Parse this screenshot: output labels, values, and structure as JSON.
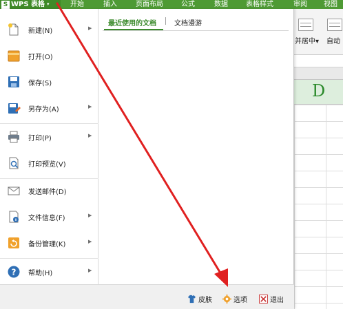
{
  "app": {
    "logo_glyph": "S",
    "title": "WPS 表格",
    "caret": "▾"
  },
  "ribbon_tabs": [
    "开始",
    "插入",
    "页面布局",
    "公式",
    "数据",
    "表格样式",
    "审阅",
    "视图"
  ],
  "menu_items": [
    {
      "label": "新建(N)",
      "icon": "new-doc-icon",
      "submenu": true
    },
    {
      "label": "打开(O)",
      "icon": "folder-open-icon",
      "submenu": false
    },
    {
      "label": "保存(S)",
      "icon": "save-icon",
      "submenu": false
    },
    {
      "label": "另存为(A)",
      "icon": "save-as-icon",
      "submenu": true
    },
    {
      "label": "打印(P)",
      "icon": "printer-icon",
      "submenu": true
    },
    {
      "label": "打印预览(V)",
      "icon": "print-preview-icon",
      "submenu": false
    },
    {
      "label": "发送邮件(D)",
      "icon": "envelope-icon",
      "submenu": false
    },
    {
      "label": "文件信息(F)",
      "icon": "file-info-icon",
      "submenu": true
    },
    {
      "label": "备份管理(K)",
      "icon": "backup-icon",
      "submenu": true
    },
    {
      "label": "帮助(H)",
      "icon": "help-icon",
      "submenu": true
    }
  ],
  "submenu_arrow": "▶",
  "doc_tabs": {
    "recent": "最近使用的文档",
    "roaming": "文档漫游"
  },
  "footer": {
    "skin": "皮肤",
    "options": "选项",
    "exit": "退出"
  },
  "sheet_bg": {
    "toolbar_labels": [
      "并居中",
      "自动"
    ],
    "label_caret": "▾",
    "column_letter": "D"
  },
  "colors": {
    "brand_green": "#4e9a34",
    "active_tab_green": "#3b8a2c",
    "annotation_red": "#e02020"
  }
}
